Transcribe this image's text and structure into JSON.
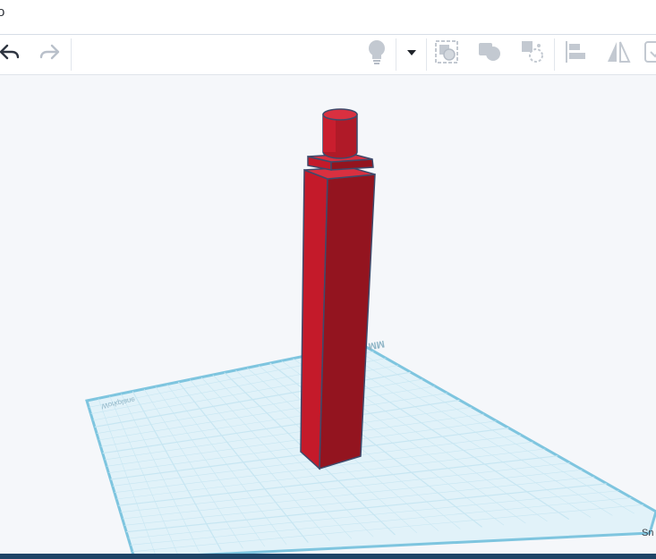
{
  "window": {
    "title_fragment": "o"
  },
  "toolbar": {
    "undo_icon": "undo-icon",
    "redo_icon": "redo-icon",
    "buttons": [
      {
        "name": "show-hide-icon",
        "label": "lightbulb"
      },
      {
        "name": "visibility-dropdown-icon",
        "label": "chevron-down"
      },
      {
        "name": "group-icon",
        "label": "group"
      },
      {
        "name": "ungroup-icon",
        "label": "ungroup"
      },
      {
        "name": "hole-solid-icon",
        "label": "hole"
      },
      {
        "name": "align-icon",
        "label": "align"
      },
      {
        "name": "mirror-icon",
        "label": "mirror"
      },
      {
        "name": "cruise-icon",
        "label": "cruise"
      }
    ]
  },
  "workplane": {
    "watermark": "Workplane",
    "scale_label": "MM"
  },
  "scene": {
    "object_color": "#c41a2a",
    "object_shade": "#93141f",
    "object_outline": "#3f4a6b",
    "grid_color": "#c7e6f2",
    "grid_edge": "#7ec5df"
  },
  "footer": {
    "snap_label": "Sn"
  }
}
